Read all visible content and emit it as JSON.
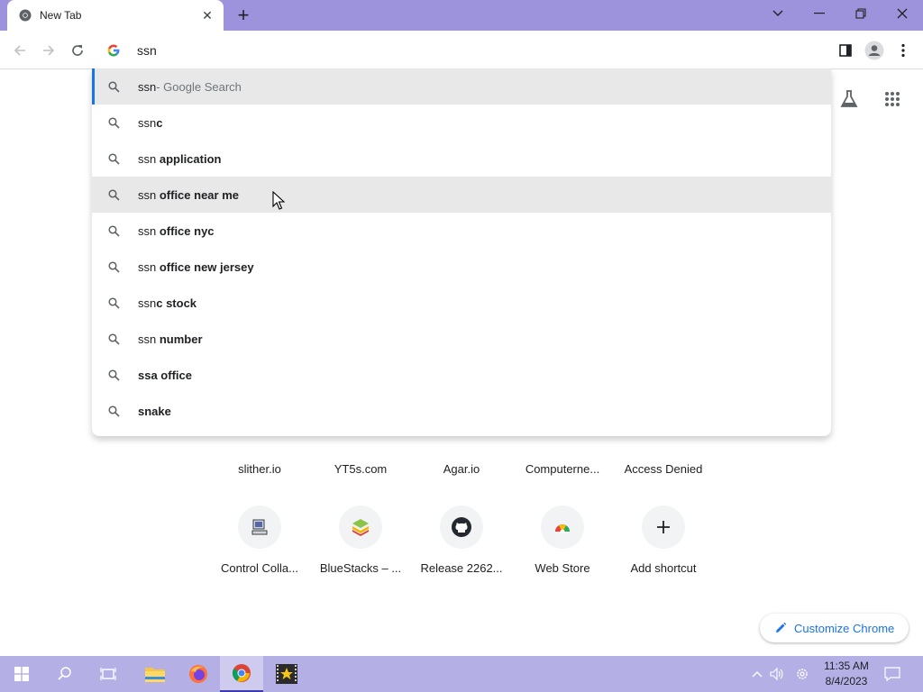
{
  "tab": {
    "title": "New Tab"
  },
  "omnibox": {
    "query": "ssn"
  },
  "suggestions": [
    {
      "plain": "ssn",
      "bold": "",
      "desc": " - Google Search"
    },
    {
      "plain": "ssn",
      "bold": "c",
      "desc": ""
    },
    {
      "plain": "ssn ",
      "bold": "application",
      "desc": ""
    },
    {
      "plain": "ssn ",
      "bold": "office near me",
      "desc": ""
    },
    {
      "plain": "ssn ",
      "bold": "office nyc",
      "desc": ""
    },
    {
      "plain": "ssn ",
      "bold": "office new jersey",
      "desc": ""
    },
    {
      "plain": "ssn",
      "bold": "c stock",
      "desc": ""
    },
    {
      "plain": "ssn ",
      "bold": "number",
      "desc": ""
    },
    {
      "plain": "",
      "bold": "ssa office",
      "desc": ""
    },
    {
      "plain": "",
      "bold": "snake",
      "desc": ""
    }
  ],
  "shortcuts_row1": [
    "slither.io",
    "YT5s.com",
    "Agar.io",
    "Computerne...",
    "Access Denied"
  ],
  "shortcuts_row2": [
    "Control Colla...",
    "BlueStacks – ...",
    "Release 2262...",
    "Web Store",
    "Add shortcut"
  ],
  "customize": {
    "label": "Customize Chrome"
  },
  "clock": {
    "time": "11:35 AM",
    "date": "8/4/2023"
  },
  "colors": {
    "titlebar": "#9c93dc",
    "taskbar": "#b4b0e6",
    "accent": "#1a73e8"
  }
}
